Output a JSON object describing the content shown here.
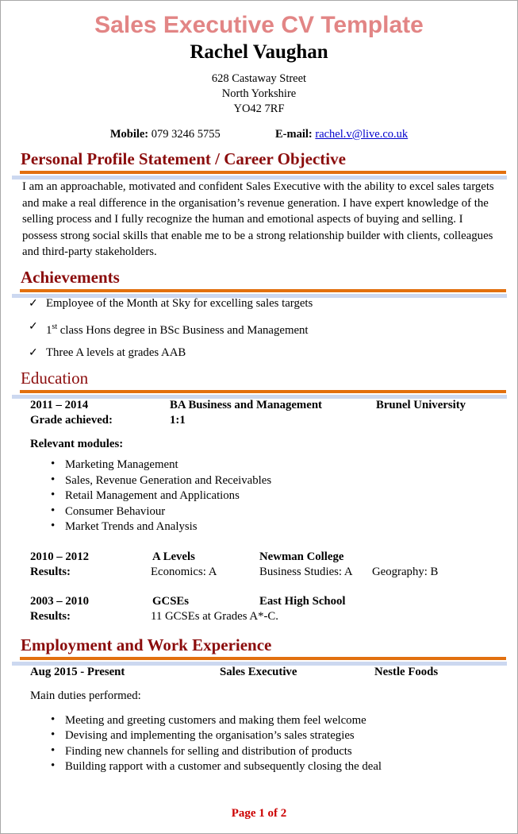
{
  "document": {
    "title": "Sales Executive CV Template",
    "name": "Rachel Vaughan",
    "address": {
      "line1": "628 Castaway Street",
      "line2": "North Yorkshire",
      "line3": "YO42 7RF"
    },
    "contact": {
      "mobile_label": "Mobile:",
      "mobile_value": "079 3246 5755",
      "email_label": "E-mail:",
      "email_value": "rachel.v@live.co.uk"
    },
    "footer": "Page 1 of 2"
  },
  "sections": {
    "profile": {
      "heading": "Personal Profile Statement / Career Objective",
      "text": "I am an approachable, motivated and confident Sales Executive with the ability to excel sales targets and make a real difference in the organisation’s revenue generation. I have expert knowledge of the selling process and I fully recognize the human and emotional aspects of buying and selling.  I possess strong social skills that enable me to be a strong relationship builder with clients, colleagues and third-party stakeholders."
    },
    "achievements": {
      "heading": "Achievements",
      "items": [
        {
          "text": "Employee of the Month at Sky for excelling sales targets"
        },
        {
          "prefix": "1",
          "sup": "st",
          "text": " class Hons degree in BSc Business and Management"
        },
        {
          "text": "Three A levels at grades AAB"
        }
      ]
    },
    "education": {
      "heading": "Education",
      "entries": [
        {
          "date": "2011 – 2014",
          "title": "BA Business and Management",
          "institution": "Brunel University",
          "grade_label": "Grade achieved:",
          "grade_value": "1:1",
          "modules_label": "Relevant modules:",
          "modules": [
            "Marketing Management",
            "Sales, Revenue Generation and Receivables",
            "Retail Management and Applications",
            "Consumer Behaviour",
            "Market Trends and Analysis"
          ]
        },
        {
          "date": "2010 – 2012",
          "title": "A Levels",
          "institution": "Newman College",
          "results_label": "Results:",
          "result_1": "Economics: A",
          "result_2": "Business Studies: A",
          "result_3": "Geography: B"
        },
        {
          "date": "2003 – 2010",
          "title": "GCSEs",
          "institution": "East High School",
          "results_label": "Results:",
          "result_1": "11 GCSEs at Grades A*-C."
        }
      ]
    },
    "employment": {
      "heading": "Employment and Work Experience",
      "entries": [
        {
          "date": "Aug 2015 - Present",
          "role": "Sales Executive",
          "company": "Nestle Foods",
          "duties_label": "Main duties performed:",
          "duties": [
            "Meeting and greeting customers and making them feel welcome",
            "Devising and implementing the organisation’s sales strategies",
            "Finding new channels for selling and distribution of products",
            "Building rapport with a customer and subsequently closing the deal"
          ]
        }
      ]
    }
  },
  "icons": {
    "check": "✓",
    "bullet": "•"
  },
  "colors": {
    "title": "#e28585",
    "heading": "#8b0c0c",
    "rule_orange": "#e2700f",
    "rule_blue": "#ccd8f0",
    "link": "#0000cc",
    "footer": "#cc0000"
  }
}
